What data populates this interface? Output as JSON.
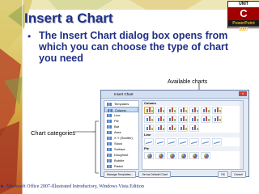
{
  "slide": {
    "title": "Insert a Chart",
    "bullet_mark": "•",
    "bullet_text": "The Insert Chart dialog box opens from which you can choose the type of chart you need",
    "callout_available": "Available charts",
    "callout_categories": "Chart categories",
    "footer": "Microsoft Office 2007-Illustrated Introductory, Windows Vista Edition",
    "footer_arrow": "►"
  },
  "badge": {
    "line1": "UNIT",
    "line2": "C",
    "line3": "PowerPoint 2007"
  },
  "dialog": {
    "title": "Insert Chart",
    "close": "x",
    "categories": [
      "Templates",
      "Column",
      "Line",
      "Pie",
      "Bar",
      "Area",
      "X Y (Scatter)",
      "Stock",
      "Surface",
      "Doughnut",
      "Bubble",
      "Radar"
    ],
    "selected_category": "Column",
    "sections": [
      "Column",
      "Line",
      "Pie"
    ],
    "buttons_left": [
      "Manage Templates...",
      "Set as Default Chart"
    ],
    "buttons_right": [
      "OK",
      "Cancel"
    ]
  },
  "colors": {
    "title": "#1f2f86",
    "accent_red": "#a00000",
    "series": [
      "#4f7fc4",
      "#c0504d",
      "#9bbb59"
    ]
  }
}
